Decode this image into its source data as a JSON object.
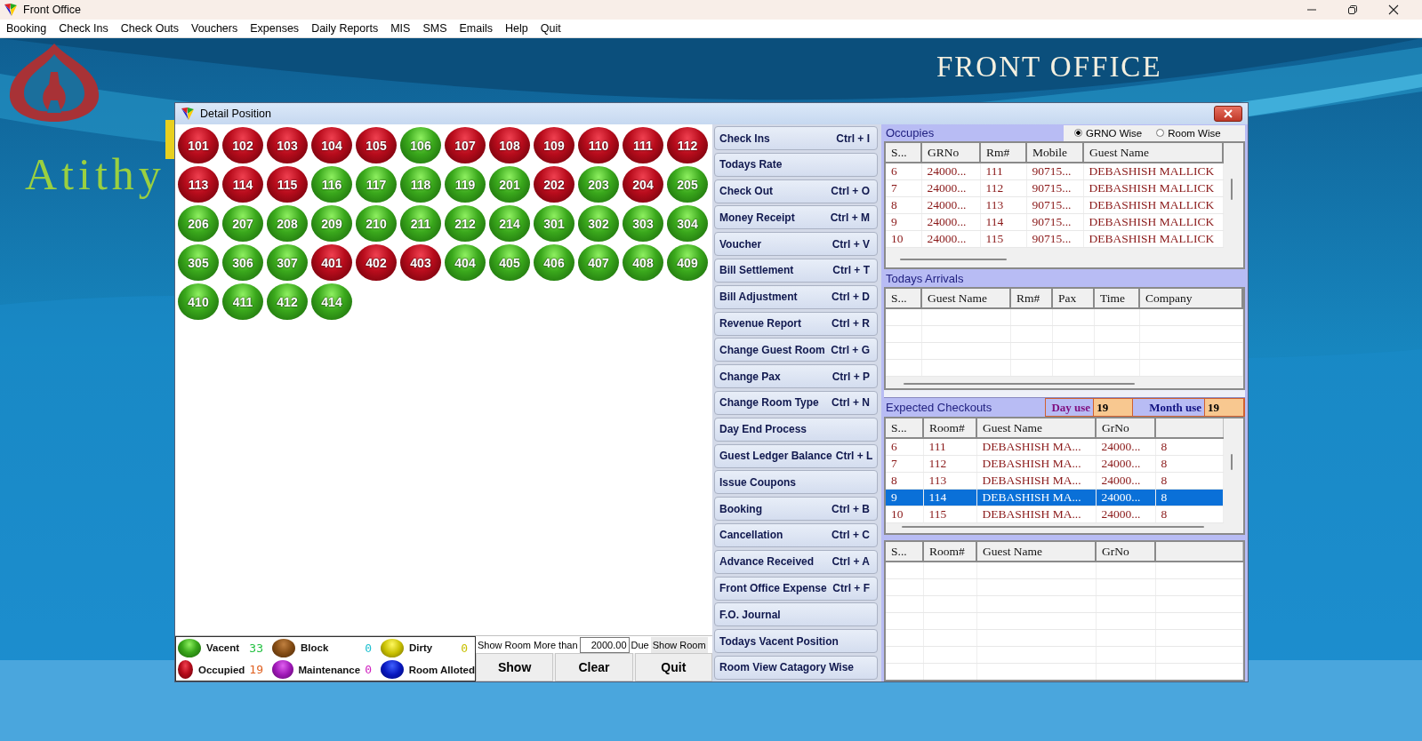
{
  "window": {
    "title": "Front Office"
  },
  "menu": [
    "Booking",
    "Check Ins",
    "Check Outs",
    "Vouchers",
    "Expenses",
    "Daily Reports",
    "MIS",
    "SMS",
    "Emails",
    "Help",
    "Quit"
  ],
  "banner": {
    "title": "FRONT OFFICE",
    "brand": "Atithy"
  },
  "dialog": {
    "title": "Detail Position",
    "rooms": [
      {
        "number": "101",
        "kind": "occupied"
      },
      {
        "number": "102",
        "kind": "occupied"
      },
      {
        "number": "103",
        "kind": "occupied"
      },
      {
        "number": "104",
        "kind": "occupied"
      },
      {
        "number": "105",
        "kind": "occupied"
      },
      {
        "number": "106",
        "kind": "vacant"
      },
      {
        "number": "107",
        "kind": "occupied"
      },
      {
        "number": "108",
        "kind": "occupied"
      },
      {
        "number": "109",
        "kind": "occupied"
      },
      {
        "number": "110",
        "kind": "occupied"
      },
      {
        "number": "111",
        "kind": "occupied"
      },
      {
        "number": "112",
        "kind": "occupied"
      },
      {
        "number": "113",
        "kind": "occupied"
      },
      {
        "number": "114",
        "kind": "occupied"
      },
      {
        "number": "115",
        "kind": "occupied"
      },
      {
        "number": "116",
        "kind": "vacant"
      },
      {
        "number": "117",
        "kind": "vacant"
      },
      {
        "number": "118",
        "kind": "vacant"
      },
      {
        "number": "119",
        "kind": "vacant"
      },
      {
        "number": "201",
        "kind": "vacant"
      },
      {
        "number": "202",
        "kind": "occupied"
      },
      {
        "number": "203",
        "kind": "vacant"
      },
      {
        "number": "204",
        "kind": "occupied"
      },
      {
        "number": "205",
        "kind": "vacant"
      },
      {
        "number": "206",
        "kind": "vacant"
      },
      {
        "number": "207",
        "kind": "vacant"
      },
      {
        "number": "208",
        "kind": "vacant"
      },
      {
        "number": "209",
        "kind": "vacant"
      },
      {
        "number": "210",
        "kind": "vacant"
      },
      {
        "number": "211",
        "kind": "vacant"
      },
      {
        "number": "212",
        "kind": "vacant"
      },
      {
        "number": "214",
        "kind": "vacant"
      },
      {
        "number": "301",
        "kind": "vacant"
      },
      {
        "number": "302",
        "kind": "vacant"
      },
      {
        "number": "303",
        "kind": "vacant"
      },
      {
        "number": "304",
        "kind": "vacant"
      },
      {
        "number": "305",
        "kind": "vacant"
      },
      {
        "number": "306",
        "kind": "vacant"
      },
      {
        "number": "307",
        "kind": "vacant"
      },
      {
        "number": "401",
        "kind": "occupied"
      },
      {
        "number": "402",
        "kind": "occupied"
      },
      {
        "number": "403",
        "kind": "occupied"
      },
      {
        "number": "404",
        "kind": "vacant"
      },
      {
        "number": "405",
        "kind": "vacant"
      },
      {
        "number": "406",
        "kind": "vacant"
      },
      {
        "number": "407",
        "kind": "vacant"
      },
      {
        "number": "408",
        "kind": "vacant"
      },
      {
        "number": "409",
        "kind": "vacant"
      },
      {
        "number": "410",
        "kind": "vacant"
      },
      {
        "number": "411",
        "kind": "vacant"
      },
      {
        "number": "412",
        "kind": "vacant"
      },
      {
        "number": "414",
        "kind": "vacant"
      }
    ],
    "legend": [
      {
        "label": "Vacent",
        "count": "33",
        "kind": "vacant"
      },
      {
        "label": "Block",
        "count": "0",
        "kind": "block"
      },
      {
        "label": "Dirty",
        "count": "0",
        "kind": "dirty"
      },
      {
        "label": "Occupied",
        "count": "19",
        "kind": "occupied"
      },
      {
        "label": "Maintenance",
        "count": "0",
        "kind": "maintenance"
      },
      {
        "label": "Room Alloted",
        "kind": "alloted"
      }
    ],
    "filter": {
      "label": "Show Room More than",
      "value": "2000.00",
      "suffix": "Due",
      "button": "Show Room"
    },
    "actions": [
      "Show",
      "Clear",
      "Quit"
    ],
    "commands": [
      {
        "label": "Check Ins",
        "shortcut": "Ctrl + I"
      },
      {
        "label": "Todays Rate"
      },
      {
        "label": "Check Out",
        "shortcut": "Ctrl + O"
      },
      {
        "label": "Money Receipt",
        "shortcut": "Ctrl + M"
      },
      {
        "label": "Voucher",
        "shortcut": "Ctrl + V"
      },
      {
        "label": "Bill Settlement",
        "shortcut": "Ctrl + T"
      },
      {
        "label": "Bill Adjustment",
        "shortcut": "Ctrl + D"
      },
      {
        "label": "Revenue Report",
        "shortcut": "Ctrl + R"
      },
      {
        "label": "Change Guest Room",
        "shortcut": "Ctrl + G"
      },
      {
        "label": "Change Pax",
        "shortcut": "Ctrl + P"
      },
      {
        "label": "Change Room Type",
        "shortcut": "Ctrl + N"
      },
      {
        "label": "Day End Process"
      },
      {
        "label": "Guest Ledger Balance",
        "shortcut": "Ctrl + L"
      },
      {
        "label": "Issue Coupons"
      },
      {
        "label": "Booking",
        "shortcut": "Ctrl + B"
      },
      {
        "label": "Cancellation",
        "shortcut": "Ctrl + C"
      },
      {
        "label": "Advance Received",
        "shortcut": "Ctrl + A"
      },
      {
        "label": "Front Office Expense",
        "shortcut": "Ctrl + F"
      },
      {
        "label": "F.O. Journal"
      },
      {
        "label": "Todays Vacent Position"
      },
      {
        "label": "Room View Catagory Wise"
      }
    ],
    "occupies": {
      "title": "Occupies",
      "sort_options": [
        {
          "label": "GRNO Wise",
          "selected": true
        },
        {
          "label": "Room Wise",
          "selected": false
        }
      ],
      "columns": [
        "S...",
        "GRNo",
        "Rm#",
        "Mobile",
        "Guest Name"
      ],
      "rows": [
        {
          "cells": [
            "6",
            "24000...",
            "111",
            "90715...",
            "DEBASHISH MALLICK"
          ],
          "selected": false
        },
        {
          "cells": [
            "7",
            "24000...",
            "112",
            "90715...",
            "DEBASHISH MALLICK"
          ],
          "selected": false
        },
        {
          "cells": [
            "8",
            "24000...",
            "113",
            "90715...",
            "DEBASHISH MALLICK"
          ],
          "selected": false
        },
        {
          "cells": [
            "9",
            "24000...",
            "114",
            "90715...",
            "DEBASHISH MALLICK"
          ],
          "selected": false
        },
        {
          "cells": [
            "10",
            "24000...",
            "115",
            "90715...",
            "DEBASHISH MALLICK"
          ],
          "selected": false
        }
      ]
    },
    "todays_arrivals": {
      "title": "Todays Arrivals",
      "columns": [
        "S...",
        "Guest Name",
        "Rm#",
        "Pax",
        "Time",
        "Company"
      ]
    },
    "expected_checkouts": {
      "title": "Expected Checkouts",
      "day_use": {
        "label": "Day use",
        "value": "19"
      },
      "month_use": {
        "label": "Month use",
        "value": "19"
      },
      "columns": [
        "S...",
        "Room#",
        "Guest Name",
        "GrNo"
      ],
      "rows": [
        {
          "cells": [
            "6",
            "111",
            "DEBASHISH MA...",
            "24000...",
            "8"
          ],
          "selected": false
        },
        {
          "cells": [
            "7",
            "112",
            "DEBASHISH MA...",
            "24000...",
            "8"
          ],
          "selected": false
        },
        {
          "cells": [
            "8",
            "113",
            "DEBASHISH MA...",
            "24000...",
            "8"
          ],
          "selected": false
        },
        {
          "cells": [
            "9",
            "114",
            "DEBASHISH MA...",
            "24000...",
            "8"
          ],
          "selected": true
        },
        {
          "cells": [
            "10",
            "115",
            "DEBASHISH MA...",
            "24000...",
            "8"
          ],
          "selected": false
        }
      ]
    },
    "table_4": {
      "columns": [
        "S...",
        "Room#",
        "Guest Name",
        "GrNo"
      ]
    }
  }
}
